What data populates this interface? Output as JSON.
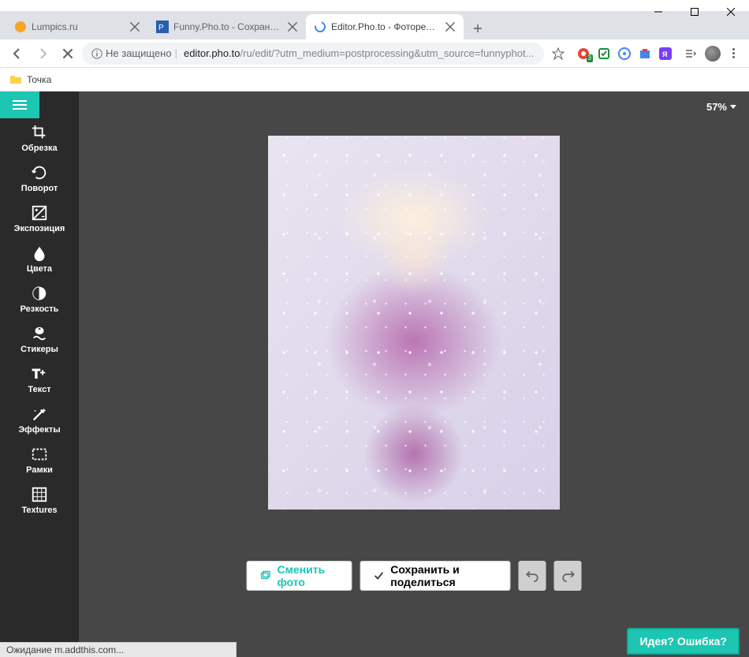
{
  "window": {
    "tabs": [
      {
        "title": "Lumpics.ru",
        "favicon_color": "#f5a623"
      },
      {
        "title": "Funny.Pho.to - Сохранить, поде...",
        "favicon_color": "#2a5db0"
      },
      {
        "title": "Editor.Pho.to - Фоторедактор о...",
        "favicon_color": "#4285f4",
        "active": true
      }
    ]
  },
  "address": {
    "insecure_label": "Не защищено",
    "url_host": "editor.pho.to",
    "url_path": "/ru/edit/?utm_medium=postprocessing&utm_source=funnyphot...",
    "star_icon": "star"
  },
  "extensions": {
    "badge": "3"
  },
  "bookmarks": {
    "item1": "Точка"
  },
  "editor": {
    "zoom": "57%",
    "tools": {
      "crop": "Обрезка",
      "rotate": "Поворот",
      "exposure": "Экспозиция",
      "colors": "Цвета",
      "sharpness": "Резкость",
      "stickers": "Стикеры",
      "text": "Текст",
      "effects": "Эффекты",
      "frames": "Рамки",
      "textures": "Textures"
    },
    "actions": {
      "change_photo": "Сменить фото",
      "save_share": "Сохранить и поделиться"
    },
    "feedback": "Идея? Ошибка?"
  },
  "status": "Ожидание m.addthis.com..."
}
